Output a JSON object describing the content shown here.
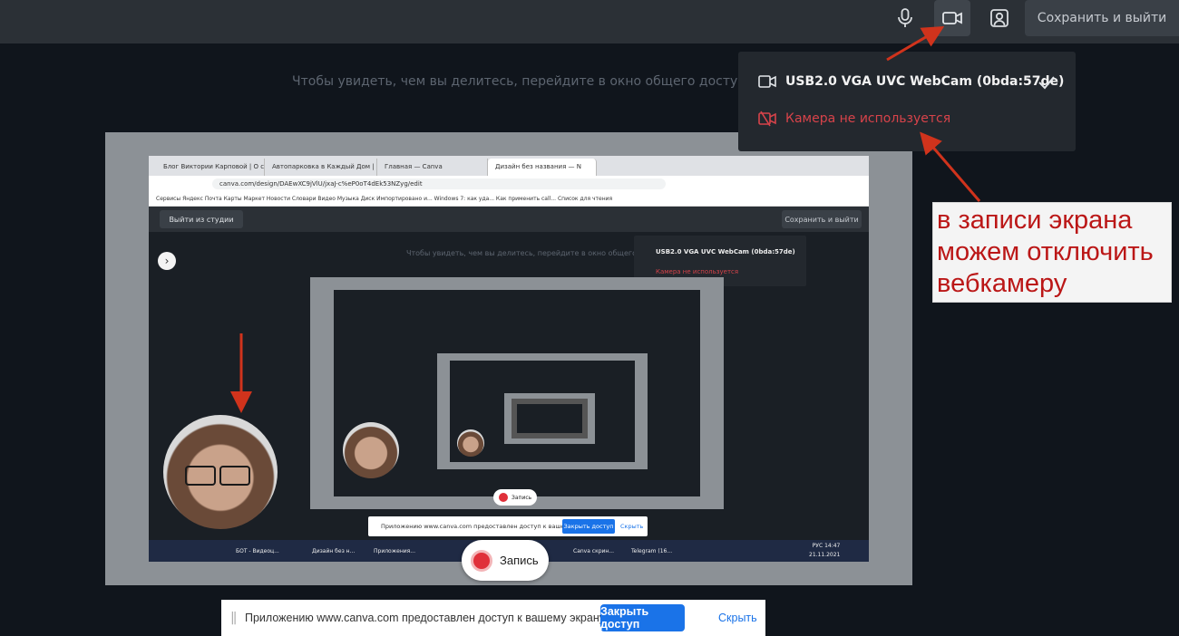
{
  "topbar": {
    "save_exit_label": "Сохранить и выйти",
    "icons": [
      "mic-icon",
      "camera-icon",
      "person-icon"
    ]
  },
  "main": {
    "hint": "Чтобы увидеть, чем вы делитесь, перейдите в окно общего доступа"
  },
  "camera_dropdown": {
    "camera_name": "USB2.0 VGA UVC WebCam (0bda:57de)",
    "camera_off": "Камера не используется"
  },
  "annotation": {
    "lines": [
      "в записи экрана",
      "можем отключить",
      "вебкамеру"
    ],
    "color": "#bb1717"
  },
  "shared_screen": {
    "browser": {
      "tabs": [
        "Блог Виктории Карповой | О с",
        "Автопарковка в Каждый Дом | «",
        "Главная — Canva",
        "Дизайн без названия — N"
      ],
      "url": "canva.com/design/DAEwXC9jVlU/jxaJ-c%eP0oT4dEk53NZyg/edit",
      "bookmarks": "Сервисы   Яндекс   Почта   Карты   Маркет   Новости   Словари   Видео   Музыка   Диск   Импортировано и...   Windows 7: как уда...   Как применить call...   Список для чтения"
    },
    "studio": {
      "exit_label": "Выйти из студии",
      "save_exit_label": "Сохранить и выйти",
      "hint": "Чтобы увидеть, чем вы делитесь, перейдите в окно общего доступа",
      "camera_name": "USB2.0 VGA UVC WebCam (0bda:57de)",
      "camera_off": "Камера не используется"
    },
    "share_bar": {
      "text": "Приложению www.canva.com предоставлен доступ к вашему экрану.",
      "stop": "Закрыть доступ",
      "hide": "Скрыть"
    },
    "record_label": "Запись",
    "taskbar": {
      "items": [
        "БОТ - Видеоц...",
        "Дизайн без н...",
        "Приложения...",
        "Canva скрин...",
        "Telegram (16..."
      ],
      "language": "РУС",
      "time": "14:47",
      "date": "21.11.2021"
    }
  },
  "record": {
    "label": "Запись",
    "dot_color": "#e0303a"
  },
  "sharebar": {
    "text": "Приложению www.canva.com предоставлен доступ к вашему экрану.",
    "stop_label": "Закрыть доступ",
    "hide_label": "Скрыть"
  }
}
